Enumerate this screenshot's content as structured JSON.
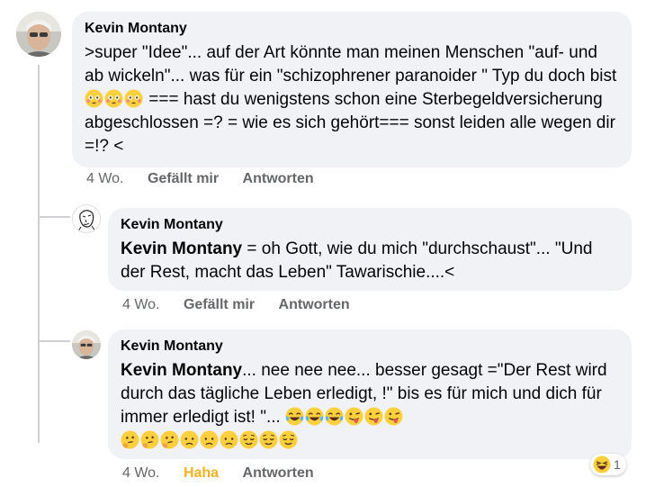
{
  "comments": [
    {
      "author": "Kevin Montany",
      "text_1": ">super \"Idee\"... auf der Art könnte man meinen Menschen \"auf- und ab wickeln\"... was für ein \"schizophrener paranoider \" Typ du doch bist",
      "text_2": "=== hast du wenigstens schon eine Sterbegeldversicherung abgeschlossen =? = wie es sich gehört=== sonst leiden alle wegen dir =!? <",
      "emojis_inline": [
        "flushed-face",
        "flushed-face",
        "flushed-face"
      ],
      "time": "4 Wo.",
      "like": "Gefällt mir",
      "reply": "Antworten"
    },
    {
      "author": "Kevin Montany",
      "mention": "Kevin Montany",
      "text": " = oh Gott, wie du mich \"durchschaust\"... \"Und der Rest, macht das Leben\" Tawarischie....<",
      "time": "4 Wo.",
      "like": "Gefällt mir",
      "reply": "Antworten"
    },
    {
      "author": "Kevin Montany",
      "mention": "Kevin Montany",
      "text": "... nee nee nee... besser gesagt =\"Der Rest wird durch das tägliche  Leben erledigt, !\" bis es für mich und dich für immer erledigt ist! \"...",
      "emojis_inline": [
        "tears-of-joy-face",
        "tears-of-joy-face",
        "tears-of-joy-face",
        "winking-tongue-face",
        "winking-tongue-face",
        "winking-tongue-face"
      ],
      "emojis_line2": [
        "thinking-face",
        "thinking-face",
        "thinking-face",
        "sad-face",
        "sad-face",
        "sad-face",
        "relieved-face",
        "relieved-face",
        "relieved-face"
      ],
      "time": "4 Wo.",
      "reaction": "Haha",
      "reply": "Antworten",
      "reaction_count": "1",
      "reaction_icon": "haha-reaction-icon"
    }
  ],
  "colors": {
    "bubble": "#f0f2f5",
    "meta": "#65676b",
    "haha": "#f7b125",
    "emoji_yellow": "#fbcf3d"
  }
}
